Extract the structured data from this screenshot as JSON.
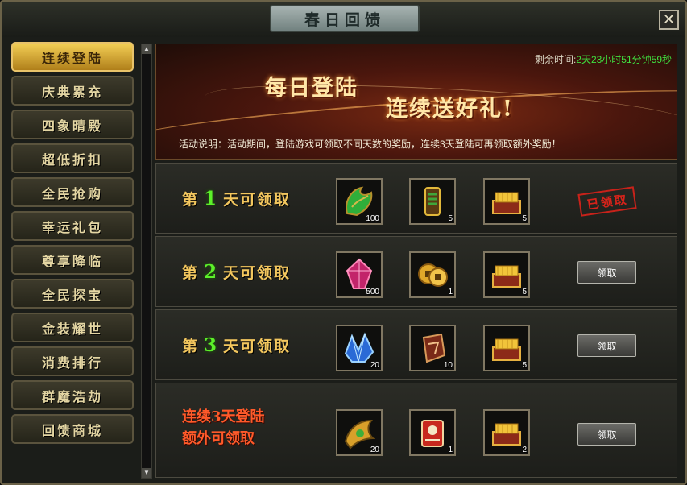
{
  "window": {
    "title": "春日回馈",
    "close_glyph": "✕"
  },
  "sidebar": {
    "items": [
      {
        "label": "连续登陆",
        "active": true
      },
      {
        "label": "庆典累充"
      },
      {
        "label": "四象晴殿"
      },
      {
        "label": "超低折扣"
      },
      {
        "label": "全民抢购"
      },
      {
        "label": "幸运礼包"
      },
      {
        "label": "尊享降临"
      },
      {
        "label": "全民探宝"
      },
      {
        "label": "金装耀世"
      },
      {
        "label": "消费排行"
      },
      {
        "label": "群魔浩劫"
      },
      {
        "label": "回馈商城"
      }
    ]
  },
  "banner": {
    "remaining_label": "剩余时间:",
    "remaining_value": "2天23小时51分钟59秒",
    "headline_1": "每日登陆",
    "headline_2": "连续送好礼!",
    "description": "活动说明：活动期间，登陆游戏可领取不同天数的奖励，连续3天登陆可再领取额外奖励！"
  },
  "rows": [
    {
      "prefix": "第",
      "day": "1",
      "suffix": "天可领取",
      "claimed_stamp": "已领取",
      "items": [
        {
          "icon": "green-jade-ornament-icon",
          "qty": "100"
        },
        {
          "icon": "gold-scroll-charm-icon",
          "qty": "5"
        },
        {
          "icon": "gold-treasure-chest-icon",
          "qty": "5"
        }
      ]
    },
    {
      "prefix": "第",
      "day": "2",
      "suffix": "天可领取",
      "button": "领取",
      "items": [
        {
          "icon": "magenta-crystal-icon",
          "qty": "500"
        },
        {
          "icon": "gold-coin-icon",
          "qty": "1"
        },
        {
          "icon": "gold-treasure-chest-icon",
          "qty": "5"
        }
      ]
    },
    {
      "prefix": "第",
      "day": "3",
      "suffix": "天可领取",
      "button": "领取",
      "items": [
        {
          "icon": "blue-crystal-icon",
          "qty": "20"
        },
        {
          "icon": "red-rune-stone-icon",
          "qty": "10"
        },
        {
          "icon": "gold-treasure-chest-icon",
          "qty": "5"
        }
      ]
    },
    {
      "line1": "连续3天登陆",
      "line2": "额外可领取",
      "button": "领取",
      "items": [
        {
          "icon": "gold-ornament-wing-icon",
          "qty": "20"
        },
        {
          "icon": "red-scroll-icon",
          "qty": "1"
        },
        {
          "icon": "gold-treasure-chest-icon",
          "qty": "2"
        }
      ]
    }
  ],
  "colors": {
    "accent_gold": "#f2c65e",
    "day_green": "#5cf02a",
    "timer_green": "#3fe13f",
    "bonus_red": "#ff5a2a"
  }
}
